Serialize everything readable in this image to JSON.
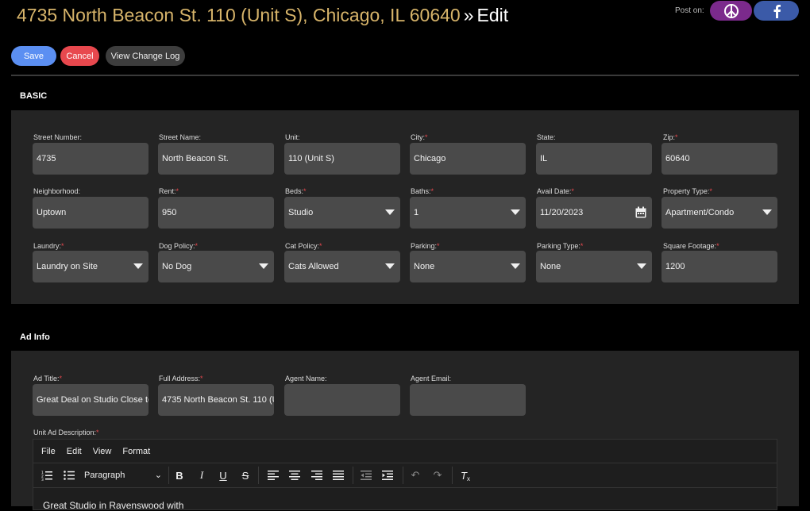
{
  "header": {
    "address": "4735 North Beacon St. 110 (Unit S), Chicago, IL 60640",
    "separator": "»",
    "edit_label": "Edit",
    "post_on_label": "Post on:"
  },
  "share_buttons": [
    {
      "icon": "peace-icon",
      "color": "#7b2a8c"
    },
    {
      "icon": "facebook-icon",
      "color": "#3b5aa8"
    }
  ],
  "actions": {
    "save_label": "Save",
    "cancel_label": "Cancel",
    "change_log_label": "View Change Log"
  },
  "basic": {
    "heading": "BASIC",
    "fields": {
      "street_number": {
        "label": "Street Number:",
        "required": false,
        "value": "4735"
      },
      "street_name": {
        "label": "Street Name:",
        "required": false,
        "value": "North Beacon St."
      },
      "unit": {
        "label": "Unit:",
        "required": false,
        "value": "110 (Unit S)"
      },
      "city": {
        "label": "City:",
        "required": true,
        "value": "Chicago"
      },
      "state": {
        "label": "State:",
        "required": false,
        "value": "IL"
      },
      "zip": {
        "label": "Zip:",
        "required": true,
        "value": "60640"
      },
      "neighborhood": {
        "label": "Neighborhood:",
        "required": false,
        "value": "Uptown"
      },
      "rent": {
        "label": "Rent:",
        "required": true,
        "value": "950"
      },
      "beds": {
        "label": "Beds:",
        "required": true,
        "value": "Studio"
      },
      "baths": {
        "label": "Baths:",
        "required": true,
        "value": "1"
      },
      "avail_date": {
        "label": "Avail Date:",
        "required": true,
        "value": "11/20/2023"
      },
      "property_type": {
        "label": "Property Type:",
        "required": true,
        "value": "Apartment/Condo"
      },
      "laundry": {
        "label": "Laundry:",
        "required": true,
        "value": "Laundry on Site"
      },
      "dog_policy": {
        "label": "Dog Policy:",
        "required": true,
        "value": "No Dog"
      },
      "cat_policy": {
        "label": "Cat Policy:",
        "required": true,
        "value": "Cats Allowed"
      },
      "parking": {
        "label": "Parking:",
        "required": true,
        "value": "None"
      },
      "parking_type": {
        "label": "Parking Type:",
        "required": true,
        "value": "None"
      },
      "square_footage": {
        "label": "Square Footage:",
        "required": true,
        "value": "1200"
      }
    }
  },
  "ad_info": {
    "heading": "Ad Info",
    "fields": {
      "ad_title": {
        "label": "Ad Title:",
        "required": true,
        "value": "Great Deal on Studio Close to"
      },
      "full_address": {
        "label": "Full Address:",
        "required": true,
        "value": "4735 North Beacon St. 110 (U"
      },
      "agent_name": {
        "label": "Agent Name:",
        "required": false,
        "value": ""
      },
      "agent_email": {
        "label": "Agent Email:",
        "required": false,
        "value": ""
      }
    },
    "description_label": "Unit Ad Description:",
    "description_required": true,
    "editor": {
      "menu": [
        "File",
        "Edit",
        "View",
        "Format"
      ],
      "block_format": "Paragraph",
      "content": "Great Studio in Ravenswood with"
    }
  },
  "required_marker": "*",
  "colors": {
    "accent_gold": "#d7b46a",
    "save": "#5b8ff2",
    "cancel": "#e8484e",
    "panel": "#242424",
    "field": "#4a4a4a"
  }
}
